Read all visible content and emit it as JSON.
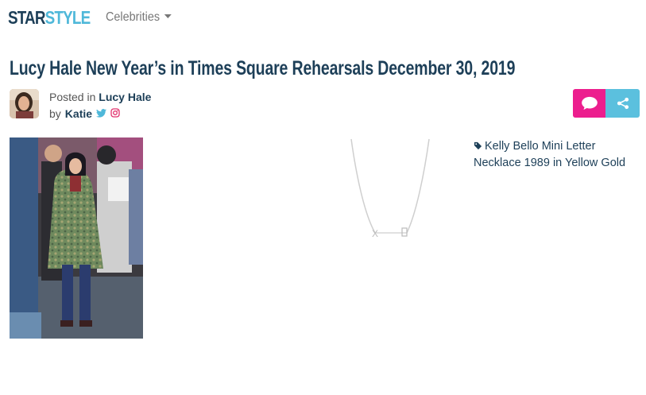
{
  "header": {
    "logo_part1": "STAR",
    "logo_part2": "STYLE",
    "nav_label": "Celebrities"
  },
  "article": {
    "title": "Lucy Hale New Year’s in Times Square Rehearsals December 30, 2019",
    "posted_prefix": "Posted in",
    "category": "Lucy Hale",
    "by_prefix": "by",
    "author": "Katie"
  },
  "product": {
    "label": "Kelly Bello Mini Letter Necklace 1989 in Yellow Gold"
  },
  "colors": {
    "brand_dark": "#1d3f58",
    "brand_light": "#4fb8d9",
    "comment_button": "#ec1e8e",
    "share_button": "#5bc0de"
  },
  "icons": {
    "twitter": "twitter-icon",
    "instagram": "instagram-icon",
    "comment": "comment-icon",
    "share": "share-icon",
    "tag": "tag-icon"
  }
}
